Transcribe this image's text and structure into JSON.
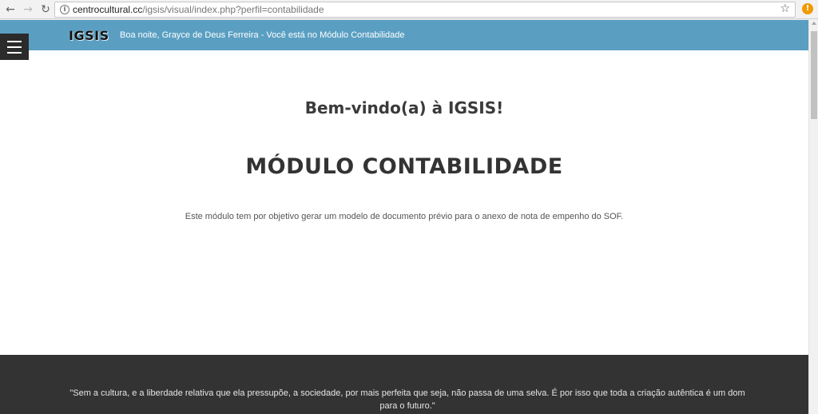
{
  "browser": {
    "url_host": "centrocultural.cc",
    "url_path": "/igsis/visual/index.php?perfil=contabilidade"
  },
  "header": {
    "logo": "IGSIS",
    "greeting": "Boa noite, Grayce de Deus Ferreira - Você está no Módulo Contabilidade"
  },
  "main": {
    "welcome": "Bem-vindo(a) à IGSIS!",
    "module_title": "MÓDULO CONTABILIDADE",
    "description": "Este módulo tem por objetivo gerar um modelo de documento prévio para o anexo de nota de empenho do SOF."
  },
  "footer": {
    "quote": "\"Sem a cultura, e a liberdade relativa que ela pressupõe, a sociedade, por mais perfeita que seja, não passa de uma selva. É por isso que toda a criação autêntica é um dom para o futuro.\""
  },
  "colors": {
    "topbar": "#5a9fc2",
    "footer": "#333333"
  },
  "icons": {
    "back": "arrow-left-icon",
    "forward": "arrow-right-icon",
    "reload": "reload-icon",
    "info": "info-icon",
    "bookmark": "star-icon",
    "extension": "alert-extension-icon",
    "menu": "hamburger-icon"
  }
}
